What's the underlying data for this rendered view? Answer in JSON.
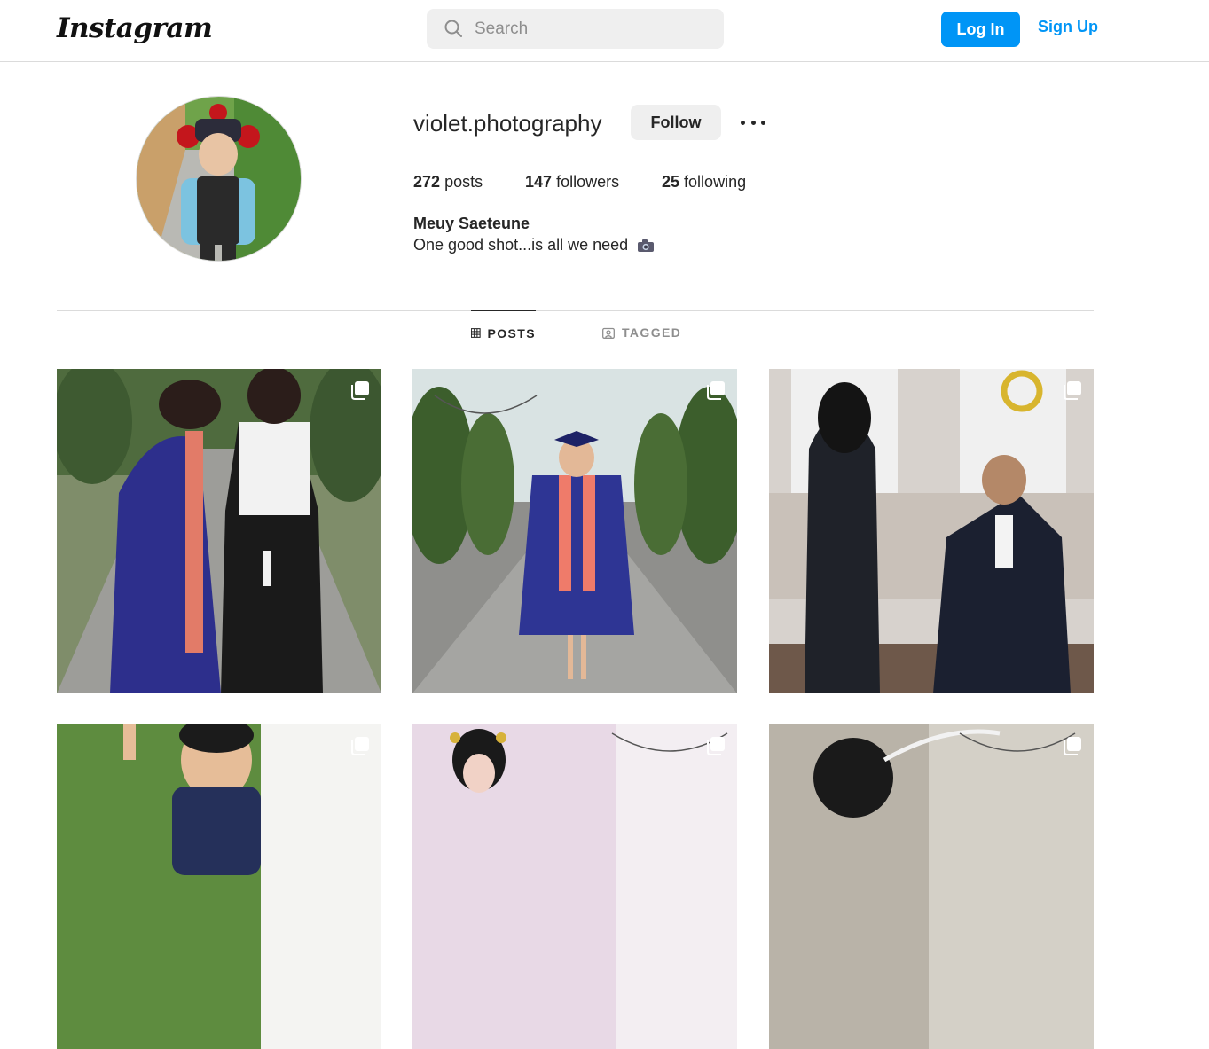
{
  "header": {
    "logo_text": "Instagram",
    "search_placeholder": "Search",
    "login_label": "Log In",
    "signup_label": "Sign Up"
  },
  "profile": {
    "username": "violet.photography",
    "follow_label": "Follow",
    "stats": {
      "posts_count": "272",
      "posts_label": "posts",
      "followers_count": "147",
      "followers_label": "followers",
      "following_count": "25",
      "following_label": "following"
    },
    "full_name": "Meuy Saeteune",
    "bio": "One good shot...is all we need"
  },
  "tabs": [
    {
      "label": "POSTS",
      "icon": "grid-icon",
      "active": true
    },
    {
      "label": "TAGGED",
      "icon": "tagged-icon",
      "active": false
    }
  ],
  "posts": [
    {
      "subject": "graduation-cap-adjust",
      "icon": "multiple-photos-icon"
    },
    {
      "subject": "graduate-portrait",
      "icon": "multiple-photos-icon"
    },
    {
      "subject": "marriage-proposal",
      "icon": "multiple-photos-icon"
    },
    {
      "subject": "child-peace-sign",
      "icon": "multiple-photos-icon"
    },
    {
      "subject": "girl-portrait",
      "icon": "multiple-photos-icon"
    },
    {
      "subject": "hooded-figure",
      "icon": "multiple-photos-icon"
    }
  ],
  "colors": {
    "accent": "#0095f6",
    "border": "#dbdbdb",
    "secondary_text": "#8e8e8e"
  }
}
